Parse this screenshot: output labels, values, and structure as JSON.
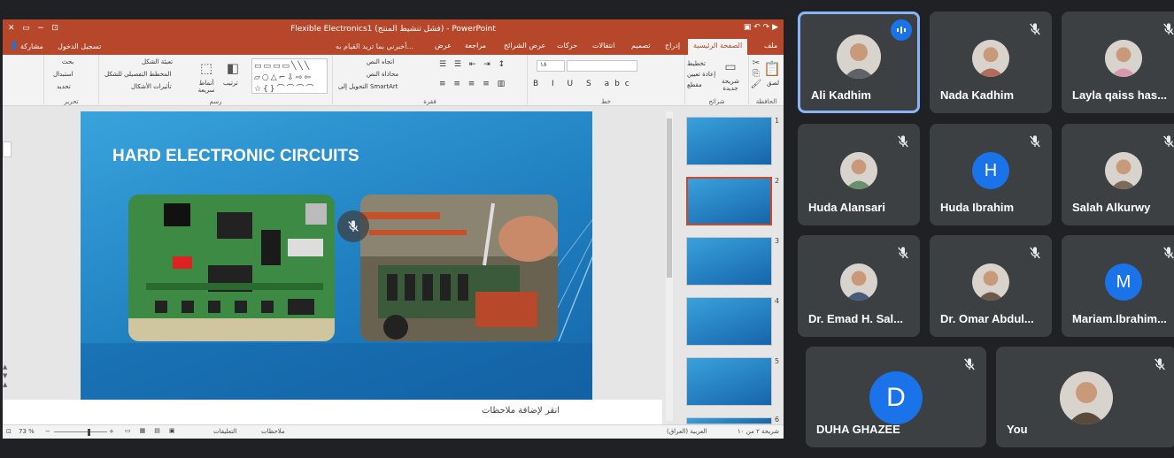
{
  "ppt": {
    "title": "Flexible Electronics1 (فشل تنشيط المنتج) - PowerPoint",
    "share": "مشاركة",
    "signin": "تسجيل الدخول",
    "tell_me": "أخبرني بما تريد القيام به...",
    "tabs": [
      "ملف",
      "الصفحة الرئيسية",
      "إدراج",
      "تصميم",
      "انتقالات",
      "حركات",
      "عرض الشرائح",
      "مراجعة",
      "عرض"
    ],
    "ribbon": {
      "paste": "لصق",
      "new_slide": "شريحة جديدة",
      "layout": "تخطيط",
      "reset": "إعادة تعيين",
      "section": "مقطع",
      "font_size": "١٨",
      "text_direction": "اتجاه النص",
      "align_text": "محاذاة النص",
      "smartart": "التحويل إلى SmartArt",
      "arrange": "ترتيب",
      "quick_styles": "أنماط سريعة",
      "shape_fill": "تعبئة الشكل",
      "shape_outline": "المخطط التفصيلي للشكل",
      "shape_effects": "تأثيرات الأشكال",
      "find": "بحث",
      "replace": "استبدال",
      "select": "تحديد",
      "groups": {
        "clipboard": "الحافظة",
        "slides": "شرائح",
        "font": "خط",
        "paragraph": "فقرة",
        "drawing": "رسم",
        "editing": "تحرير"
      }
    },
    "slide": {
      "title": "HARD ELECTRONIC CIRCUITS"
    },
    "notes_placeholder": "انقر لإضافة ملاحظات",
    "thumbnails": [
      {
        "num": "1"
      },
      {
        "num": "2"
      },
      {
        "num": "3"
      },
      {
        "num": "4"
      },
      {
        "num": "5"
      },
      {
        "num": "6"
      }
    ],
    "status": {
      "slide_of": "شريحة ٢ من ١٠",
      "language": "العربية (العراق)",
      "notes": "ملاحظات",
      "comments": "التعليقات",
      "zoom": "73 %"
    }
  },
  "participants": [
    {
      "name": "Ali Kadhim",
      "speaking": true,
      "avatar": "photo",
      "avatar_color": "#5f6368"
    },
    {
      "name": "Nada Kadhim",
      "speaking": false,
      "avatar": "photo",
      "avatar_color": "#b36b5a"
    },
    {
      "name": "Layla qaiss has...",
      "speaking": false,
      "avatar": "photo",
      "avatar_color": "#d69ab0"
    },
    {
      "name": "Huda Alansari",
      "speaking": false,
      "avatar": "photo",
      "avatar_color": "#6b8e6b"
    },
    {
      "name": "Huda Ibrahim",
      "speaking": false,
      "avatar": "letter",
      "letter": "H",
      "avatar_color": "#1a73e8"
    },
    {
      "name": "Salah Alkurwy",
      "speaking": false,
      "avatar": "photo",
      "avatar_color": "#7a6a5a"
    },
    {
      "name": "Dr. Emad H. Sal...",
      "speaking": false,
      "avatar": "photo",
      "avatar_color": "#4a5a7a"
    },
    {
      "name": "Dr. Omar Abdul...",
      "speaking": false,
      "avatar": "photo",
      "avatar_color": "#6a5a4a"
    },
    {
      "name": "Mariam.Ibrahim...",
      "speaking": false,
      "avatar": "letter",
      "letter": "M",
      "avatar_color": "#1a73e8"
    },
    {
      "name": "DUHA GHAZEE",
      "speaking": false,
      "avatar": "letter",
      "letter": "D",
      "avatar_color": "#1a73e8"
    },
    {
      "name": "You",
      "speaking": false,
      "avatar": "photo",
      "avatar_color": "#5a4a3a"
    }
  ]
}
